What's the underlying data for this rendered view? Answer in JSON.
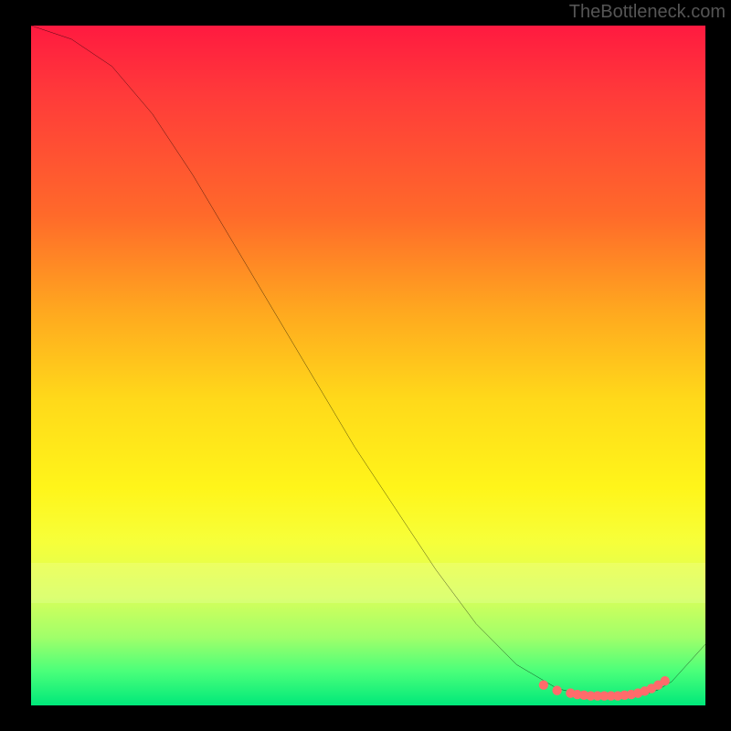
{
  "watermark": "TheBottleneck.com",
  "chart_data": {
    "type": "line",
    "title": "",
    "xlabel": "",
    "ylabel": "",
    "xlim": [
      0,
      100
    ],
    "ylim": [
      0,
      100
    ],
    "series": [
      {
        "name": "curve",
        "x": [
          0,
          6,
          12,
          18,
          24,
          30,
          36,
          42,
          48,
          54,
          60,
          66,
          72,
          78,
          82,
          85,
          88,
          91,
          93,
          95,
          100
        ],
        "values": [
          100,
          98,
          94,
          87,
          78,
          68,
          58,
          48,
          38,
          29,
          20,
          12,
          6,
          2.5,
          1.5,
          1.3,
          1.3,
          1.6,
          2.3,
          3.5,
          9
        ]
      }
    ],
    "markers": {
      "name": "highlight-dots",
      "color": "#ff6b6b",
      "x": [
        76,
        78,
        80,
        81,
        82,
        83,
        84,
        85,
        86,
        87,
        88,
        89,
        90,
        91,
        92,
        93,
        94
      ],
      "values": [
        3.0,
        2.2,
        1.8,
        1.6,
        1.5,
        1.4,
        1.4,
        1.4,
        1.4,
        1.4,
        1.5,
        1.6,
        1.8,
        2.1,
        2.5,
        3.0,
        3.6
      ]
    },
    "gradient_stops": [
      {
        "pos": 0.0,
        "color": "#ff1a40"
      },
      {
        "pos": 0.28,
        "color": "#ff6a2a"
      },
      {
        "pos": 0.55,
        "color": "#ffd91a"
      },
      {
        "pos": 0.76,
        "color": "#f6ff3a"
      },
      {
        "pos": 0.95,
        "color": "#4aff7a"
      },
      {
        "pos": 1.0,
        "color": "#00e87a"
      }
    ]
  }
}
